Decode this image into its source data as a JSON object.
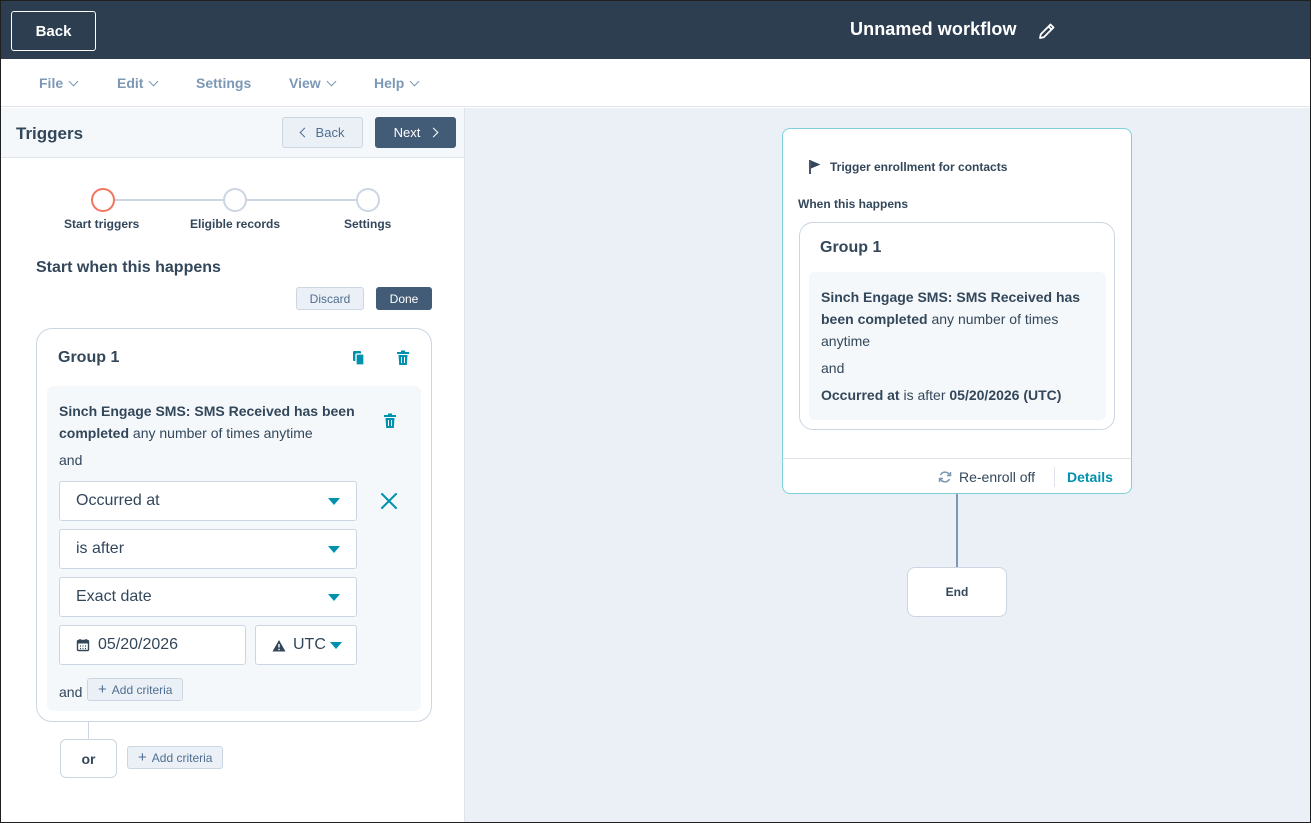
{
  "topbar": {
    "back_label": "Back",
    "workflow_title": "Unnamed workflow",
    "edit_icon": "pencil-icon"
  },
  "menu": {
    "items": [
      {
        "label": "File",
        "has_dropdown": true
      },
      {
        "label": "Edit",
        "has_dropdown": true
      },
      {
        "label": "Settings",
        "has_dropdown": false
      },
      {
        "label": "View",
        "has_dropdown": true
      },
      {
        "label": "Help",
        "has_dropdown": true
      }
    ]
  },
  "panel": {
    "title": "Triggers",
    "back_label": "Back",
    "next_label": "Next",
    "steps": [
      {
        "label": "Start triggers",
        "active": true
      },
      {
        "label": "Eligible records",
        "active": false
      },
      {
        "label": "Settings",
        "active": false
      }
    ],
    "section_title": "Start when this happens",
    "discard_label": "Discard",
    "done_label": "Done",
    "group": {
      "title": "Group 1",
      "copy_icon": "copy-icon",
      "delete_icon": "trash-icon",
      "criteria": {
        "bold_text": "Sinch Engage SMS: SMS Received has been completed",
        "rest_text": " any number of times anytime",
        "and_label": "and",
        "property_select": "Occurred at",
        "operator_select": "is after",
        "date_type_select": "Exact date",
        "date_value": "05/20/2026",
        "timezone": "UTC",
        "and_label_2": "and",
        "add_criteria_label": "Add criteria"
      }
    },
    "or_label": "or",
    "add_criteria_label": "Add criteria"
  },
  "canvas": {
    "trigger_header": "Trigger enrollment for contacts",
    "when_label": "When this happens",
    "group_title": "Group 1",
    "criteria_bold": "Sinch Engage SMS: SMS Received has been completed",
    "criteria_rest": " any number of times anytime",
    "and_label": "and",
    "occurred_bold": "Occurred at",
    "occurred_mid": " is after ",
    "occurred_date": "05/20/2026 (UTC)",
    "reenroll_label": "Re-enroll off",
    "details_label": "Details",
    "end_label": "End"
  },
  "colors": {
    "header_bg": "#2d3e50",
    "accent": "#0091ae",
    "active_step": "#f2755e",
    "canvas_bg": "#eaf0f6"
  }
}
